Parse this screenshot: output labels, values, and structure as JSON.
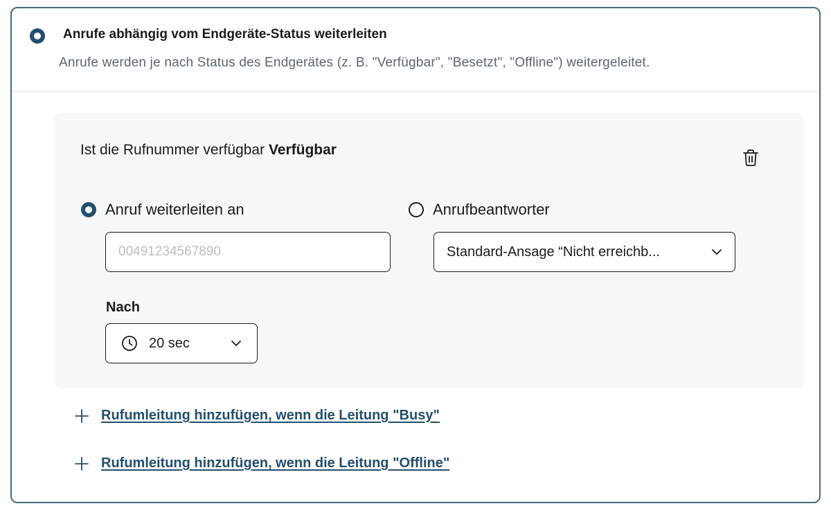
{
  "header": {
    "title": "Anrufe abhängig vom Endgeräte-Status weiterleiten",
    "description": "Anrufe werden je nach Status des Endgerätes (z. B. \"Verfügbar\", \"Besetzt\", \"Offline\") weitergeleitet.",
    "selected": true
  },
  "rule": {
    "title_prefix": "Ist die Rufnummer verfügbar",
    "title_status": "Verfügbar",
    "delete_icon": "trash-icon",
    "options": [
      {
        "label": "Anruf weiterleiten an",
        "selected": true
      },
      {
        "label": "Anrufbeantworter",
        "selected": false
      }
    ],
    "phone_input": {
      "value": "",
      "placeholder": "00491234567890"
    },
    "greeting_select": {
      "value": "Standard-Ansage “Nicht erreichb..."
    },
    "delay": {
      "label": "Nach",
      "value": "20 sec",
      "icon": "clock-icon"
    }
  },
  "add_links": [
    {
      "label": "Rufumleitung hinzufügen, wenn die Leitung \"Busy\"",
      "icon": "plus-icon"
    },
    {
      "label": "Rufumleitung hinzufügen, wenn die Leitung \"Offline\"",
      "icon": "plus-icon"
    }
  ],
  "colors": {
    "accent": "#234e6e",
    "border": "#4a6a80",
    "panel_bg": "#f6f7f8",
    "muted_text": "#5c6470"
  }
}
